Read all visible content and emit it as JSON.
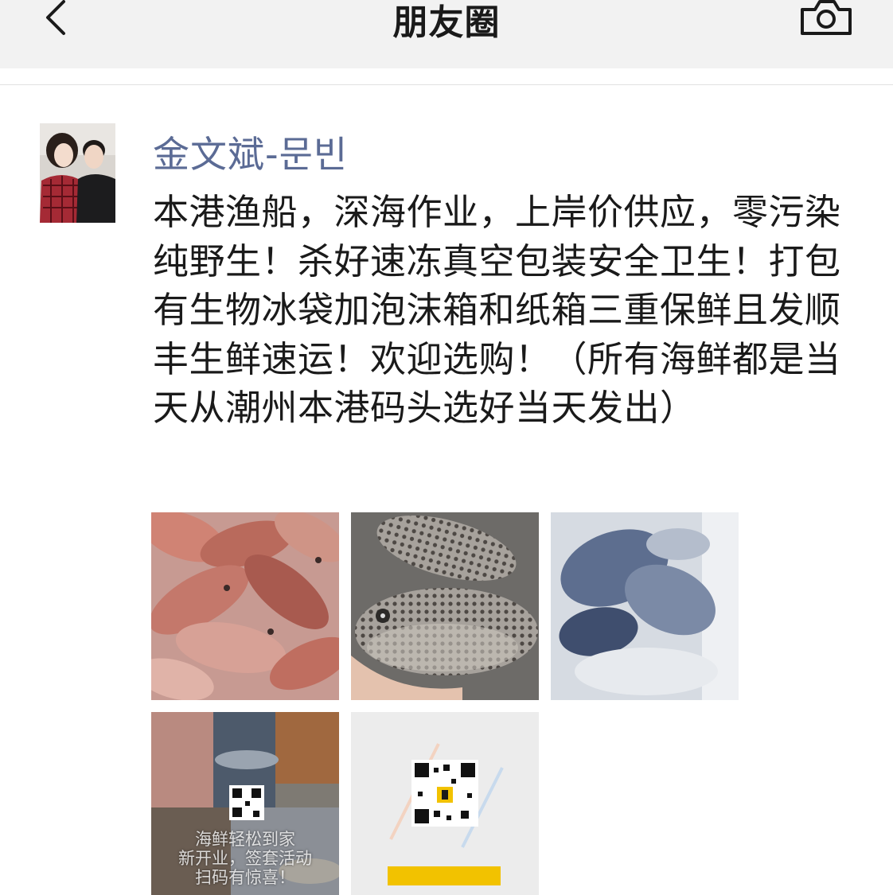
{
  "header": {
    "title": "朋友圈",
    "back_icon": "chevron-left-icon",
    "camera_icon": "camera-icon"
  },
  "post": {
    "author": "金文斌-문빈",
    "text": "本港渔船，深海作业，上岸价供应，零污染纯野生！杀好速冻真空包装安全卫生！打包有生物冰袋加泡沫箱和纸箱三重保鲜且发顺丰生鲜速运！欢迎选购！（所有海鲜都是当天从潮州本港码头选好当天发出）",
    "photos": [
      {
        "subject": "red-fish"
      },
      {
        "subject": "spotted-pufferfish"
      },
      {
        "subject": "frozen-fish-in-ice"
      },
      {
        "subject": "seafood-promo-collage",
        "lines": [
          "海鲜轻松到家",
          "新开业，签套活动",
          "扫码有惊喜！"
        ]
      },
      {
        "subject": "qr-code-card"
      }
    ]
  },
  "colors": {
    "header_bg": "#f2f2f2",
    "author": "#5b6b95",
    "text": "#1a1a1a"
  }
}
